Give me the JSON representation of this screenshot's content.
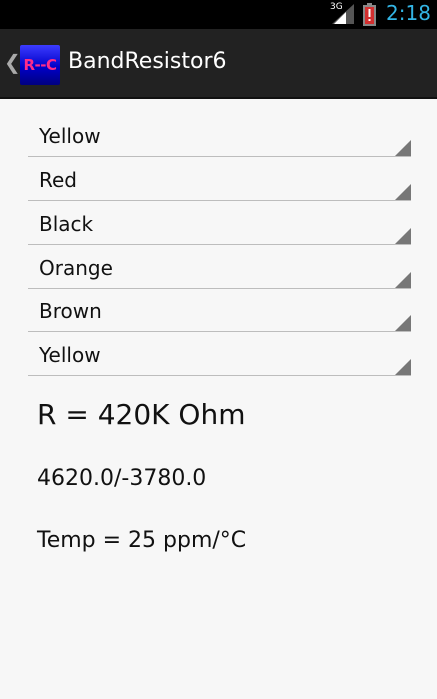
{
  "status_bar": {
    "network": "3G",
    "time": "2:18",
    "accent_color": "#33b5e5",
    "icons": [
      "signal-icon",
      "battery-alert-icon"
    ]
  },
  "action_bar": {
    "icon_text": "R--C",
    "title": "BandResistor6"
  },
  "spinners": [
    {
      "value": "Yellow"
    },
    {
      "value": "Red"
    },
    {
      "value": "Black"
    },
    {
      "value": "Orange"
    },
    {
      "value": "Brown"
    },
    {
      "value": "Yellow"
    }
  ],
  "results": {
    "resistance": "R = 420K Ohm",
    "tolerance_range": "4620.0/-3780.0",
    "temperature": "Temp = 25 ppm/°C"
  }
}
